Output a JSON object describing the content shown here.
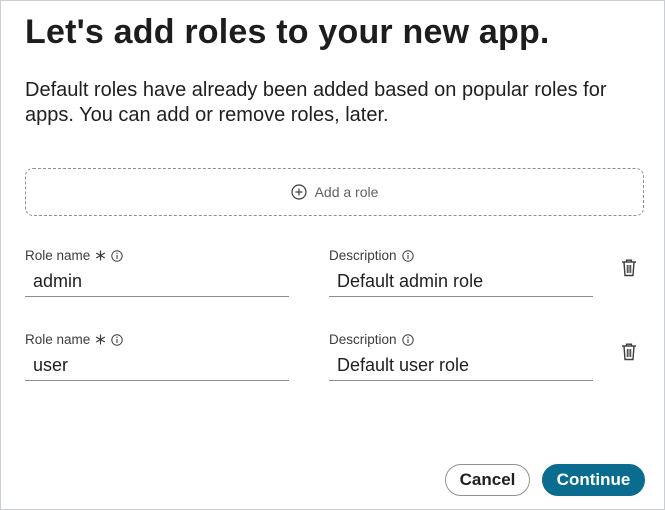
{
  "dialog": {
    "title": "Let's add roles to your new app.",
    "intro": "Default roles have already been added based on popular roles for apps. You can add or remove roles, later."
  },
  "add_role": {
    "label": "Add a role",
    "icon": "plus-circle-icon"
  },
  "roles": [
    {
      "name_label": "Role name",
      "required_marker": "*",
      "name_value": "admin",
      "description_label": "Description",
      "description_value": "Default admin role"
    },
    {
      "name_label": "Role name",
      "required_marker": "*",
      "name_value": "user",
      "description_label": "Description",
      "description_value": "Default user role"
    }
  ],
  "actions": {
    "cancel_label": "Cancel",
    "continue_label": "Continue"
  },
  "colors": {
    "primary": "#0a6d8f",
    "border": "#c9ced3",
    "dashed_border": "#8c9196"
  }
}
